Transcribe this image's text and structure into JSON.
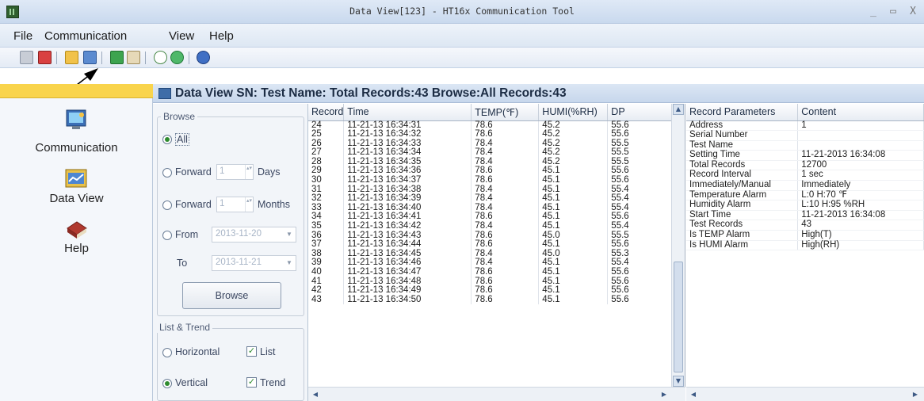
{
  "window": {
    "title": "Data View[123] - HT16x Communication Tool",
    "controls": {
      "minimize": "_",
      "maximize": "▭",
      "close": "X"
    }
  },
  "menu": [
    "File",
    "Communication",
    "View",
    "Help"
  ],
  "toolbar_icons": [
    "save-icon",
    "delete-icon",
    "open-folder-icon",
    "export-icon",
    "export-image-icon",
    "settings-icon",
    "add-icon",
    "refresh-icon",
    "about-icon"
  ],
  "nav": {
    "items": [
      {
        "label": "Communication",
        "icon": "communication-icon"
      },
      {
        "label": "Data View",
        "icon": "data-view-icon"
      },
      {
        "label": "Help",
        "icon": "help-book-icon"
      }
    ]
  },
  "header": {
    "text": "Data View  SN:  Test Name:   Total Records:43  Browse:All  Records:43"
  },
  "browse": {
    "title": "Browse",
    "all_label": "All",
    "forward_days": {
      "value": "1",
      "unit": "Days"
    },
    "forward_months": {
      "value": "1",
      "unit": "Months"
    },
    "forward_label": "Forward",
    "from_label": "From",
    "from_value": "2013-11-20",
    "to_label": "To",
    "to_value": "2013-11-21",
    "button": "Browse"
  },
  "list_trend": {
    "title": "List & Trend",
    "horizontal": "Horizontal",
    "vertical": "Vertical",
    "list": "List",
    "trend": "Trend"
  },
  "records": {
    "columns": [
      "Record",
      "Time",
      "TEMP(℉)",
      "HUMI(%RH)",
      "DP"
    ],
    "rows": [
      [
        "24",
        "11-21-13 16:34:31",
        "78.6",
        "45.2",
        "55.6"
      ],
      [
        "25",
        "11-21-13 16:34:32",
        "78.6",
        "45.2",
        "55.6"
      ],
      [
        "26",
        "11-21-13 16:34:33",
        "78.4",
        "45.2",
        "55.5"
      ],
      [
        "27",
        "11-21-13 16:34:34",
        "78.4",
        "45.2",
        "55.5"
      ],
      [
        "28",
        "11-21-13 16:34:35",
        "78.4",
        "45.2",
        "55.5"
      ],
      [
        "29",
        "11-21-13 16:34:36",
        "78.6",
        "45.1",
        "55.6"
      ],
      [
        "30",
        "11-21-13 16:34:37",
        "78.6",
        "45.1",
        "55.6"
      ],
      [
        "31",
        "11-21-13 16:34:38",
        "78.4",
        "45.1",
        "55.4"
      ],
      [
        "32",
        "11-21-13 16:34:39",
        "78.4",
        "45.1",
        "55.4"
      ],
      [
        "33",
        "11-21-13 16:34:40",
        "78.4",
        "45.1",
        "55.4"
      ],
      [
        "34",
        "11-21-13 16:34:41",
        "78.6",
        "45.1",
        "55.6"
      ],
      [
        "35",
        "11-21-13 16:34:42",
        "78.4",
        "45.1",
        "55.4"
      ],
      [
        "36",
        "11-21-13 16:34:43",
        "78.6",
        "45.0",
        "55.5"
      ],
      [
        "37",
        "11-21-13 16:34:44",
        "78.6",
        "45.1",
        "55.6"
      ],
      [
        "38",
        "11-21-13 16:34:45",
        "78.4",
        "45.0",
        "55.3"
      ],
      [
        "39",
        "11-21-13 16:34:46",
        "78.4",
        "45.1",
        "55.4"
      ],
      [
        "40",
        "11-21-13 16:34:47",
        "78.6",
        "45.1",
        "55.6"
      ],
      [
        "41",
        "11-21-13 16:34:48",
        "78.6",
        "45.1",
        "55.6"
      ],
      [
        "42",
        "11-21-13 16:34:49",
        "78.6",
        "45.1",
        "55.6"
      ],
      [
        "43",
        "11-21-13 16:34:50",
        "78.6",
        "45.1",
        "55.6"
      ]
    ]
  },
  "params": {
    "columns": [
      "Record Parameters",
      "Content"
    ],
    "rows": [
      [
        "Address",
        "1"
      ],
      [
        "Serial Number",
        ""
      ],
      [
        "Test Name",
        ""
      ],
      [
        "Setting Time",
        "11-21-2013 16:34:08"
      ],
      [
        "Total Records",
        "12700"
      ],
      [
        "Record Interval",
        "1 sec"
      ],
      [
        "Immediately/Manual",
        "Immediately"
      ],
      [
        "Temperature Alarm",
        "L:0 H:70 ℉"
      ],
      [
        "Humidity Alarm",
        "L:10 H:95 %RH"
      ],
      [
        "Start Time",
        "11-21-2013 16:34:08"
      ],
      [
        "Test Records",
        "43"
      ],
      [
        "Is TEMP Alarm",
        "High(T)"
      ],
      [
        "Is HUMI Alarm",
        "High(RH)"
      ]
    ]
  }
}
